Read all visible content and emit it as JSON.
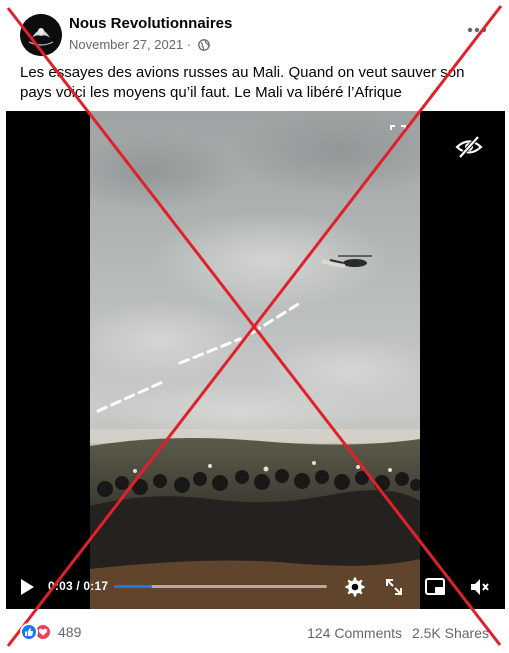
{
  "post": {
    "page_name": "Nous Revolutionnaires",
    "date": "November 27, 2021",
    "separator": " · ",
    "caption": "Les essayes des avions russes au Mali. Quand on veut sauver son pays voici les moyens qu’il faut. Le Mali va libéré l’Afrique"
  },
  "video": {
    "current_time": "0:03",
    "duration": "0:17",
    "time_display": "0:03 / 0:17",
    "progress": 0.18
  },
  "icons": {
    "more": "more-icon",
    "globe": "globe-icon",
    "hide": "eye-slash-icon",
    "play": "play-icon",
    "settings": "gear-icon",
    "fullscreen": "expand-icon",
    "pip": "picture-in-picture-icon",
    "volume": "volume-muted-icon"
  },
  "engagement": {
    "reaction_count": "489",
    "comments": "124 Comments",
    "shares": "2.5K Shares"
  },
  "colors": {
    "accent": "#1877f2",
    "love": "#f33e58",
    "cross": "#e0202a",
    "muted_text": "#65676b"
  }
}
